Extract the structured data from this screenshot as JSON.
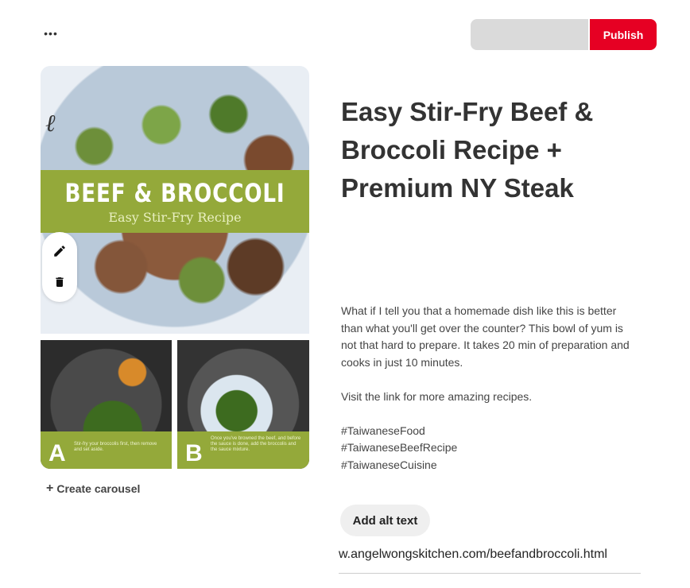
{
  "header": {
    "more_label": "•••",
    "board_select_value": "",
    "publish_label": "Publish",
    "publish_color": "#e60023"
  },
  "pin_image": {
    "title": "BEEF & BROCCOLI",
    "subtitle": "Easy Stir-Fry Recipe",
    "logo_text": "ℓ",
    "step_a": {
      "letter": "A",
      "caption": "Stir-fry your broccolis first, then remove and set aside."
    },
    "step_b": {
      "letter": "B",
      "caption": "Once you've browned the beef, and before the sauce is done, add the broccolis and the sauce mixture."
    },
    "accent_color": "#94a93a"
  },
  "tools": {
    "edit_icon": "pencil-icon",
    "delete_icon": "trash-icon"
  },
  "carousel": {
    "label": "Create carousel"
  },
  "pin": {
    "title": "Easy Stir-Fry Beef & Broccoli Recipe + Premium NY Steak",
    "description": [
      "What if I tell you that a homemade dish like this is better than what you'll get over the counter? This bowl of yum is not that hard to prepare. It takes 20 min of preparation and cooks in just 10 minutes.",
      "Visit the link for more amazing recipes."
    ],
    "hashtags": [
      "#TaiwaneseFood",
      "#TaiwaneseBeefRecipe",
      "#TaiwaneseCuisine"
    ],
    "alt_text_label": "Add alt text",
    "link_value": "w.angelwongskitchen.com/beefandbroccoli.html"
  }
}
